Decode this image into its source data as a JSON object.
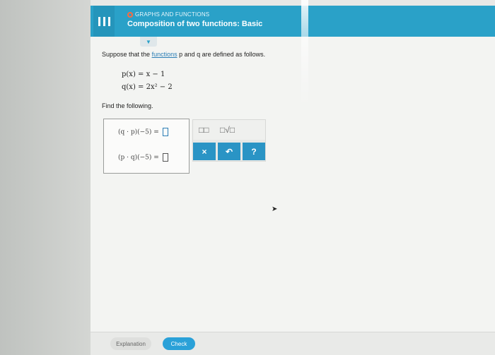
{
  "header": {
    "topic": "GRAPHS AND FUNCTIONS",
    "lesson_title": "Composition of two functions: Basic",
    "accent_color": "#2aa1c8",
    "topic_dot_color": "#ff6a3d"
  },
  "problem": {
    "prompt_before": "Suppose that the ",
    "prompt_link": "functions",
    "prompt_after": " p and q are defined as follows.",
    "eq1": "p(x) = x − 1",
    "eq2": "q(x) = 2x² − 2",
    "find": "Find the following."
  },
  "answers": {
    "row1": "(q · p)(−5) =",
    "row2": "(p · q)(−5) ="
  },
  "palette": {
    "superscript_template": "□□",
    "sqrt_template": "□√□",
    "clear_label": "×",
    "undo_label": "↶",
    "help_label": "?"
  },
  "footer": {
    "explanation_label": "Explanation",
    "check_label": "Check"
  }
}
